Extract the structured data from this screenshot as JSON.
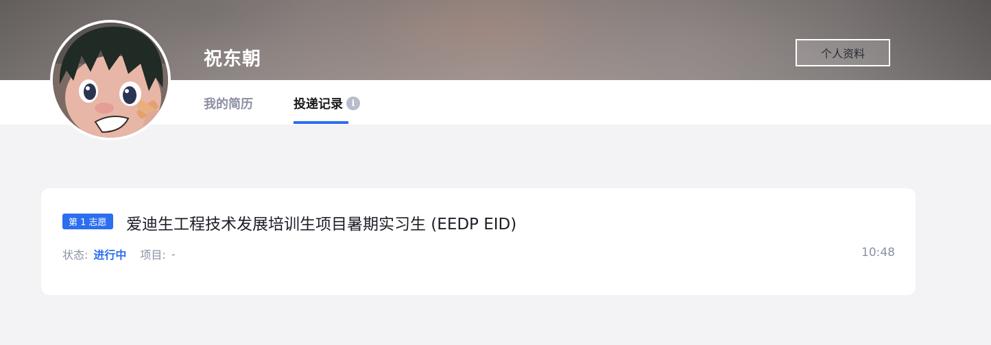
{
  "header": {
    "user_name": "祝东朝",
    "profile_button": "个人资料"
  },
  "tabs": [
    {
      "label": "我的简历",
      "active": false
    },
    {
      "label": "投递记录",
      "active": true,
      "info_icon": "info-icon"
    }
  ],
  "applications": [
    {
      "choice_badge": "第 1 志愿",
      "title": "爱迪生工程技术发展培训生项目暑期实习生 (EEDP EID)",
      "status_label": "状态:",
      "status_value": "进行中",
      "project_label": "项目:",
      "project_value": "-",
      "time": "10:48"
    }
  ],
  "colors": {
    "accent": "#2b6ef0",
    "muted_text": "#8a8fa3",
    "page_bg": "#f3f3f6"
  }
}
